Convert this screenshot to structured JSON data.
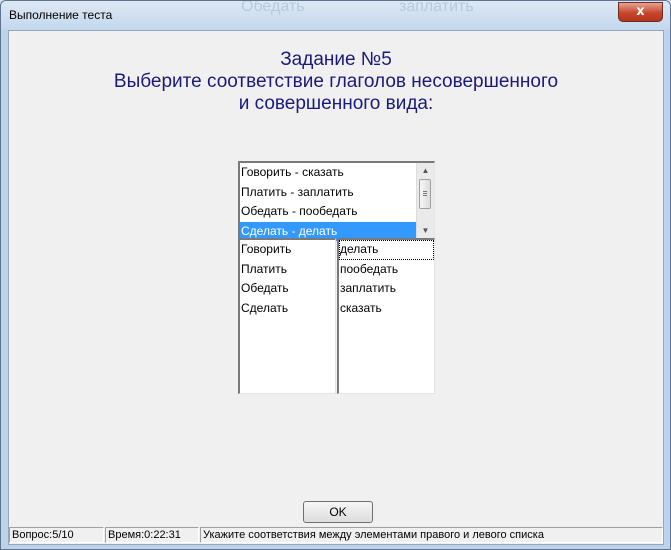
{
  "window": {
    "title": "Выполнение теста",
    "close_label": "x",
    "ghost_left": "Обедать",
    "ghost_right": "заплатить"
  },
  "heading": {
    "task": "Задание №5",
    "line1": "Выберите соответствие глаголов  несовершенного",
    "line2": "и  совершенного вида:"
  },
  "pairs_list": {
    "items": [
      "Говорить - сказать",
      "Платить - заплатить",
      "Обедать - пообедать",
      "Сделать - делать"
    ],
    "selected_index": 3
  },
  "left_list": {
    "items": [
      "Говорить",
      "Платить",
      "Обедать",
      "Сделать"
    ]
  },
  "right_list": {
    "items": [
      "делать",
      "пообедать",
      "заплатить",
      "сказать"
    ],
    "focused_index": 0
  },
  "buttons": {
    "ok": "OK"
  },
  "status": {
    "question": "Вопрос:5/10",
    "time": "Время:0:22:31",
    "hint": "Укажите соответствия между элементами правого и левого списка"
  },
  "colors": {
    "heading": "#1a1a7a",
    "selection": "#3399ff",
    "close": "#c7452b"
  }
}
